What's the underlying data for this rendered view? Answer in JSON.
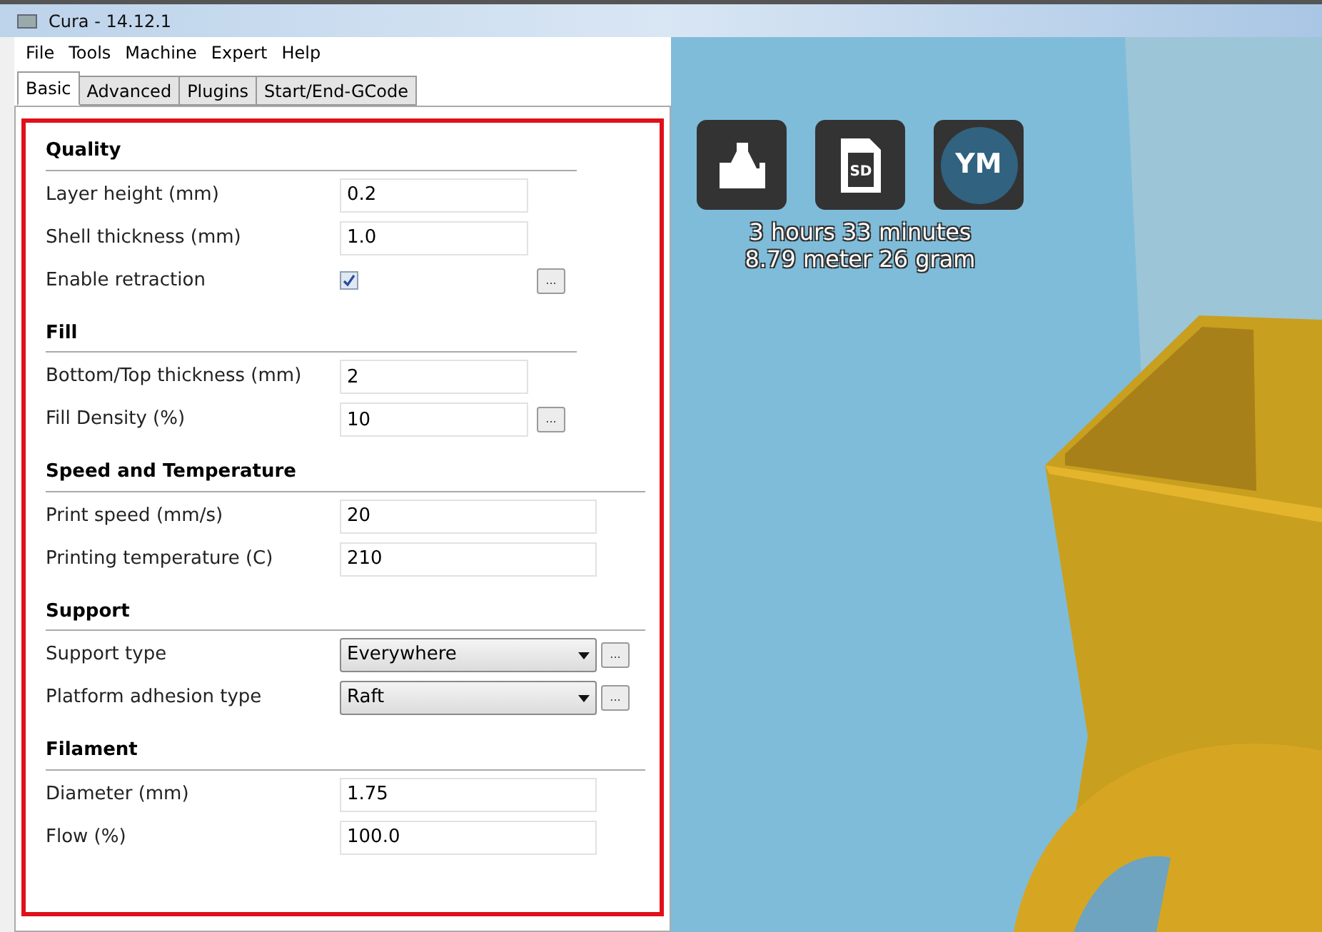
{
  "window": {
    "title": "Cura - 14.12.1"
  },
  "menu": [
    "File",
    "Tools",
    "Machine",
    "Expert",
    "Help"
  ],
  "tabs": [
    {
      "label": "Basic",
      "selected": true
    },
    {
      "label": "Advanced",
      "selected": false
    },
    {
      "label": "Plugins",
      "selected": false
    },
    {
      "label": "Start/End-GCode",
      "selected": false
    }
  ],
  "sections": [
    {
      "title": "Quality",
      "rows": [
        {
          "kind": "text",
          "label": "Layer height (mm)",
          "value": "0.2",
          "more": false
        },
        {
          "kind": "text",
          "label": "Shell thickness (mm)",
          "value": "1.0",
          "more": false
        },
        {
          "kind": "checkbox",
          "label": "Enable retraction",
          "checked": true,
          "more": true,
          "more_label": "..."
        }
      ]
    },
    {
      "title": "Fill",
      "rows": [
        {
          "kind": "text",
          "label": "Bottom/Top thickness (mm)",
          "value": "2",
          "more": false
        },
        {
          "kind": "text",
          "label": "Fill Density (%)",
          "value": "10",
          "more": true,
          "more_label": "..."
        }
      ]
    },
    {
      "title": "Speed and Temperature",
      "rows": [
        {
          "kind": "text",
          "label": "Print speed (mm/s)",
          "value": "20",
          "more": false
        },
        {
          "kind": "text",
          "label": "Printing temperature (C)",
          "value": "210",
          "more": false
        }
      ]
    },
    {
      "title": "Support",
      "rows": [
        {
          "kind": "select",
          "label": "Support type",
          "value": "Everywhere",
          "more": true,
          "more_label": "..."
        },
        {
          "kind": "select",
          "label": "Platform adhesion type",
          "value": "Raft",
          "more": true,
          "more_label": "..."
        }
      ]
    },
    {
      "title": "Filament",
      "rows": [
        {
          "kind": "text",
          "label": "Diameter (mm)",
          "value": "1.75",
          "more": false
        },
        {
          "kind": "text",
          "label": "Flow (%)",
          "value": "100.0",
          "more": false
        }
      ]
    }
  ],
  "viewport": {
    "buttons": [
      {
        "kind": "load"
      },
      {
        "kind": "sd",
        "label": "SD"
      },
      {
        "kind": "ym",
        "label": "YM"
      }
    ],
    "stats": [
      "3 hours 33 minutes",
      "8.79 meter 26 gram"
    ]
  }
}
